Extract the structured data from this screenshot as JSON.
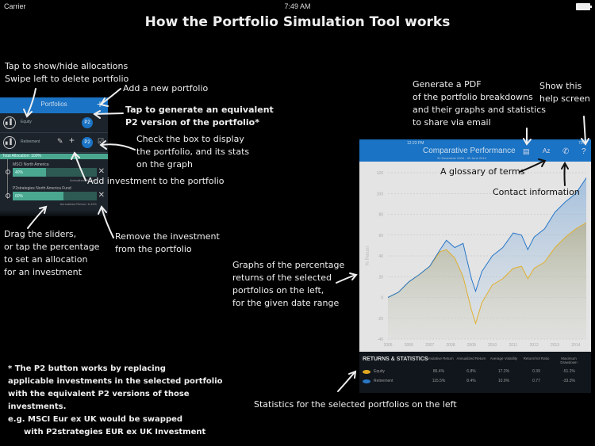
{
  "status_bar": {
    "carrier": "Carrier",
    "time": "7:49 AM"
  },
  "title": "How the Portfolio Simulation Tool works",
  "portfolios_panel": {
    "header": "Portfolios",
    "add_icon": "plus-icon",
    "portfolios": [
      {
        "name": "Equity",
        "p2_label": "P2"
      },
      {
        "name": "Retirement",
        "p2_label": "P2"
      }
    ],
    "total_allocation": "Total Allocation: 100%",
    "investments": [
      {
        "name": "MSCI North America",
        "percent": "40%",
        "allocation": 0.4,
        "annualized_return": "Annualized Return:"
      },
      {
        "name": "P2strategies North America Fund",
        "percent": "60%",
        "allocation": 0.6,
        "annualized_return": "Annualized Return: 6.44%"
      }
    ]
  },
  "chart_panel": {
    "status_time": "12:23 PM",
    "status_battery": "70%",
    "title": "Comparative Performance",
    "subtitle": "31 December 2004 - 30 June 2014",
    "toolbar_icons": [
      "pdf-icon",
      "glossary-az-icon",
      "phone-icon",
      "help-icon"
    ],
    "help_label": "?",
    "glossary_label": "Az"
  },
  "chart_data": {
    "type": "area",
    "title": "Comparative Performance",
    "xlabel": "",
    "ylabel": "% Return",
    "ylim": [
      -40,
      120
    ],
    "yticks": [
      -40,
      -20,
      0,
      20,
      40,
      60,
      80,
      100,
      120
    ],
    "x_tick_labels": [
      "2005",
      "2006",
      "2007",
      "2008",
      "2009",
      "2010",
      "2011",
      "2012",
      "2013",
      "2014"
    ],
    "xlim": [
      2005,
      2014.5
    ],
    "grid": true,
    "series": [
      {
        "name": "Equity",
        "color": "#e0b030",
        "x": [
          2005,
          2005.5,
          2006,
          2006.5,
          2007,
          2007.5,
          2007.8,
          2008.2,
          2008.6,
          2009.0,
          2009.2,
          2009.5,
          2010,
          2010.5,
          2011,
          2011.4,
          2011.7,
          2012,
          2012.5,
          2013,
          2013.5,
          2014,
          2014.5
        ],
        "values": [
          0,
          5,
          15,
          22,
          30,
          44,
          46,
          38,
          20,
          -12,
          -25,
          -5,
          12,
          18,
          28,
          30,
          18,
          28,
          34,
          48,
          58,
          66,
          72
        ]
      },
      {
        "name": "Retirement",
        "color": "#2a78c8",
        "x": [
          2005,
          2005.5,
          2006,
          2006.5,
          2007,
          2007.5,
          2007.8,
          2008.2,
          2008.6,
          2009.0,
          2009.2,
          2009.5,
          2010,
          2010.5,
          2011,
          2011.4,
          2011.7,
          2012,
          2012.5,
          2013,
          2013.5,
          2014,
          2014.5
        ],
        "values": [
          0,
          5,
          15,
          22,
          30,
          46,
          55,
          48,
          52,
          18,
          6,
          25,
          40,
          48,
          62,
          60,
          46,
          58,
          66,
          82,
          92,
          100,
          115
        ]
      }
    ]
  },
  "stats": {
    "heading": "RETURNS & STATISTICS",
    "columns": [
      "Cumulative Return",
      "Annualized Return",
      "Average Volatility",
      "Return/Vol Ratio",
      "Maximum Drawdown"
    ],
    "rows": [
      {
        "name": "Equity",
        "color": "#e0a820",
        "values": [
          "86.4%",
          "6.8%",
          "17.2%",
          "0.39",
          "-51.2%"
        ]
      },
      {
        "name": "Retirement",
        "color": "#2a78c8",
        "values": [
          "115.5%",
          "8.4%",
          "10.9%",
          "0.77",
          "-33.3%"
        ]
      }
    ]
  },
  "annotations": {
    "show_hide": [
      "Tap to show/hide allocations",
      "Swipe left to delete portfolio"
    ],
    "add_portfolio": "Add a new portfolio",
    "p2_generate": [
      "Tap to generate an equivalent",
      "P2 version of the portfolio*"
    ],
    "check_box": [
      "Check the box to display",
      "the portfolio, and its stats",
      "on the graph"
    ],
    "add_investment": "Add investment to the portfolio",
    "drag_sliders": [
      "Drag the sliders,",
      "or tap the percentage",
      "to set an allocation",
      "for an investment"
    ],
    "remove_investment": [
      "Remove the investment",
      "from the portfolio"
    ],
    "pdf": [
      "Generate a PDF",
      "of the portfolio breakdowns",
      "and their graphs and statistics",
      "to share via email"
    ],
    "help": [
      "Show this",
      "help screen"
    ],
    "glossary": "A glossary of terms",
    "contact": "Contact information",
    "graphs": [
      "Graphs of the percentage",
      "returns of the selected",
      "portfolios on the left,",
      "for the given date range"
    ],
    "statistics": "Statistics for the selected portfolios on the left",
    "footnote": [
      "* The P2 button works by replacing",
      "applicable investments in the selected portfolio",
      "with the equivalent P2 versions of those",
      "investments.",
      "e.g. MSCI Eur ex UK would be swapped",
      "with P2strategies EUR ex UK Investment"
    ]
  }
}
